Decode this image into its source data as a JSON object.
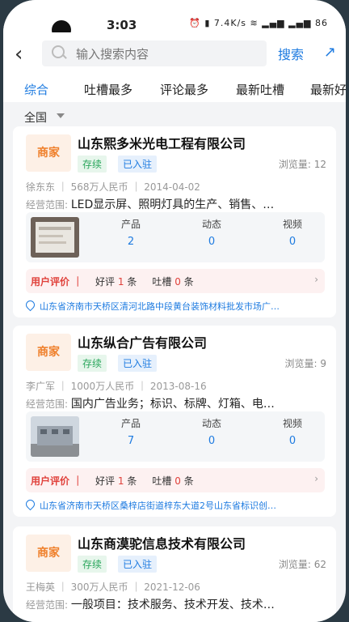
{
  "status": {
    "time": "3:03",
    "icons": "⏰ ▮ 7.4K/s ≋ ▂▄▆ ▂▄▆ 86"
  },
  "search": {
    "placeholder": "输入搜索内容",
    "button": "搜索"
  },
  "tabs": [
    "综合",
    "吐槽最多",
    "评论最多",
    "最新吐槽",
    "最新好"
  ],
  "region": "全国",
  "labels": {
    "views": "浏览量: ",
    "products": "产品",
    "news": "动态",
    "videos": "视频",
    "user_review": "用户评价",
    "good": "好评",
    "complaint": "吐槽",
    "unit": "条",
    "scope_prefix": "经营范围: "
  },
  "companies": [
    {
      "logo": "商家",
      "name": "山东熙多米光电工程有限公司",
      "tag1": "存续",
      "tag2": "已入驻",
      "views": "12",
      "legal": "徐东东",
      "capital": "568万人民币",
      "date": "2014-04-02",
      "scope": "LED显示屏、照明灯具的生产、销售、…",
      "products": "2",
      "news": "0",
      "videos": "0",
      "good": "1",
      "complaints": "0",
      "address": "山东省济南市天桥区清河北路中段黄台装饰材料批发市场广…"
    },
    {
      "logo": "商家",
      "name": "山东纵合广告有限公司",
      "tag1": "存续",
      "tag2": "已入驻",
      "views": "9",
      "legal": "李广军",
      "capital": "1000万人民币",
      "date": "2013-08-16",
      "scope": "国内广告业务；标识、标牌、灯箱、电…",
      "products": "7",
      "news": "0",
      "videos": "0",
      "good": "1",
      "complaints": "0",
      "address": "山东省济南市天桥区桑梓店街道梓东大道2号山东省标识创…"
    },
    {
      "logo": "商家",
      "name": "山东商漠驼信息技术有限公司",
      "tag1": "存续",
      "tag2": "已入驻",
      "views": "62",
      "legal": "王梅英",
      "capital": "300万人民币",
      "date": "2021-12-06",
      "scope": "一般项目：技术服务、技术开发、技术…"
    }
  ]
}
